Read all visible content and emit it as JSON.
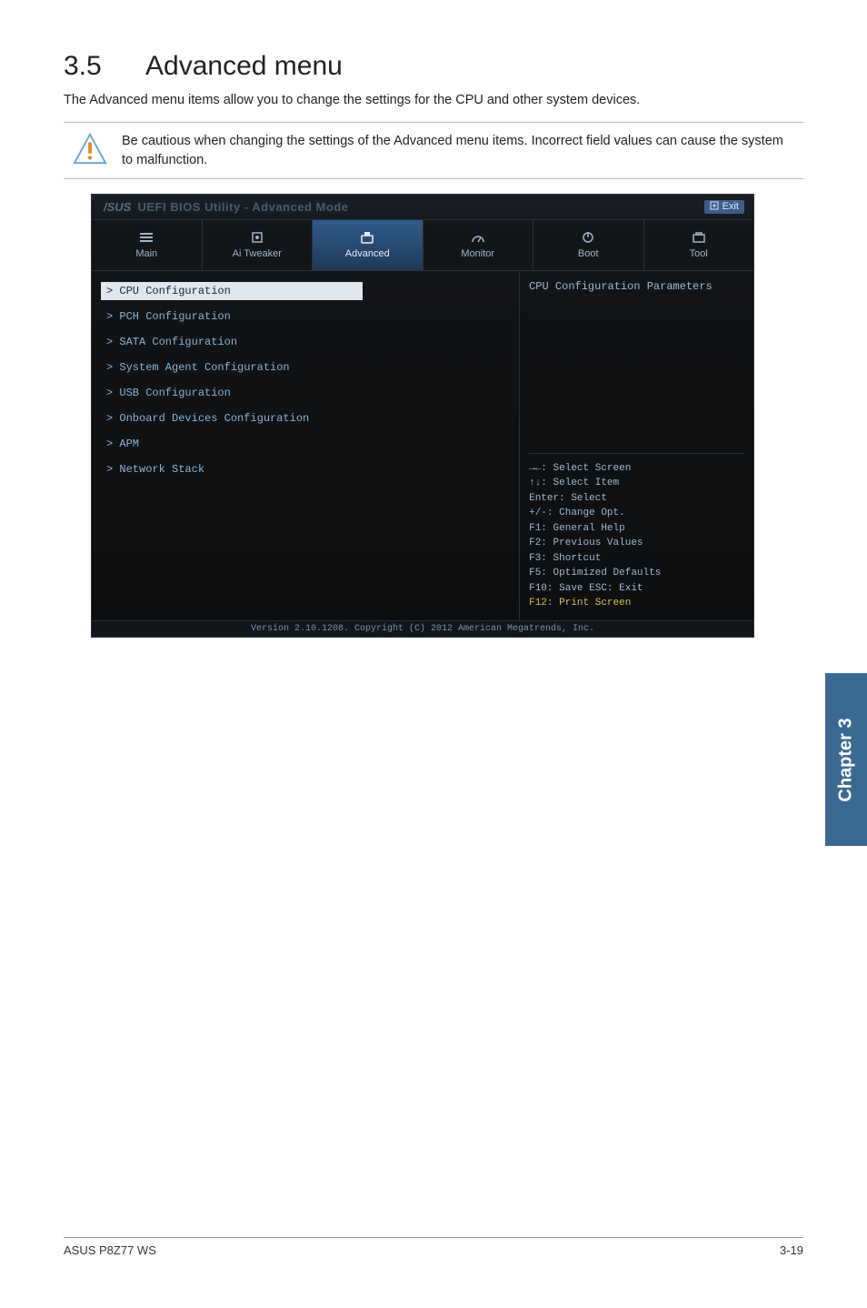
{
  "section": {
    "number": "3.5",
    "title": "Advanced menu"
  },
  "intro": "The Advanced menu items allow you to change the settings for the CPU and other system devices.",
  "note": "Be cautious when changing the settings of the Advanced menu items. Incorrect field values can cause the system to malfunction.",
  "bios": {
    "brand": "/SUS",
    "header_title": "UEFI BIOS Utility - Advanced Mode",
    "exit_label": "Exit",
    "tabs": [
      {
        "label": "Main",
        "icon": "list-icon"
      },
      {
        "label": "Ai Tweaker",
        "icon": "chip-icon"
      },
      {
        "label": "Advanced",
        "icon": "tools-icon"
      },
      {
        "label": "Monitor",
        "icon": "gauge-icon"
      },
      {
        "label": "Boot",
        "icon": "power-icon"
      },
      {
        "label": "Tool",
        "icon": "briefcase-icon"
      }
    ],
    "active_tab_index": 2,
    "menu": [
      "CPU Configuration",
      "PCH Configuration",
      "SATA Configuration",
      "System Agent Configuration",
      "USB Configuration",
      "Onboard Devices Configuration",
      "APM",
      "Network Stack"
    ],
    "selected_index": 0,
    "right_title": "CPU Configuration Parameters",
    "help": [
      "→←: Select Screen",
      "↑↓: Select Item",
      "Enter: Select",
      "+/-: Change Opt.",
      "F1: General Help",
      "F2: Previous Values",
      "F3: Shortcut",
      "F5: Optimized Defaults",
      "F10: Save  ESC: Exit",
      "F12: Print Screen"
    ],
    "footer": "Version 2.10.1208. Copyright (C) 2012 American Megatrends, Inc."
  },
  "chapter_tab": "Chapter 3",
  "footer": {
    "left": "ASUS P8Z77 WS",
    "right": "3-19"
  }
}
